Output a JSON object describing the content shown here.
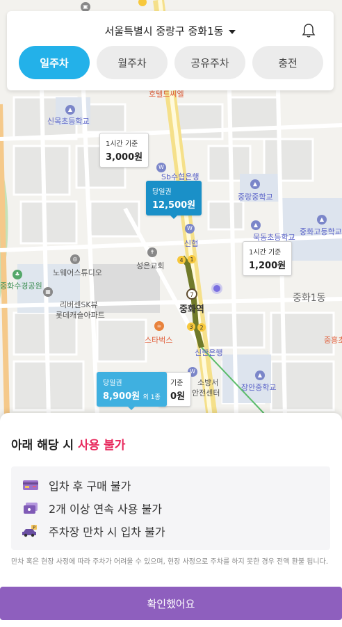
{
  "header": {
    "location": "서울특별시 중랑구 중화1동",
    "tabs": [
      {
        "label": "일주차",
        "active": true
      },
      {
        "label": "월주차",
        "active": false
      },
      {
        "label": "공유주차",
        "active": false
      },
      {
        "label": "충전",
        "active": false
      }
    ]
  },
  "map": {
    "pois": {
      "sinmok": "신목초등학교",
      "hotel": "호텔드씨엘",
      "sb": "Sb수협은행",
      "junglang_mid": "중랑중학교",
      "mukdong": "묵동초등학교",
      "junghwa_high": "중화고등학교",
      "norwest": "노웨어스튜디오",
      "seongeun": "성은교회",
      "sinhyup": "신협",
      "riversen": "리버센SK뷰",
      "rotte": "롯데캐슬아파트",
      "junghwa_station": "중화역",
      "junghwa1": "중화1동",
      "starbucks": "스타벅스",
      "shinhan": "신한은행",
      "fire": "소방서",
      "safety": "안전센터",
      "jangan": "장안중학교",
      "park": "중화수경공원",
      "junghwa_short": "중흥초",
      "gi": "기준",
      "won": "0원"
    },
    "tags": [
      {
        "line1": "1시간 기준",
        "line2": "3,000원",
        "style": "white"
      },
      {
        "line1": "당일권",
        "line2": "12,500원",
        "style": "blue"
      },
      {
        "line1": "1시간 기준",
        "line2": "1,200원",
        "style": "white"
      },
      {
        "line1": "당일권",
        "line2": "8,900원",
        "extra": "외 1종",
        "style": "lightblue"
      }
    ],
    "station_lines": [
      "4",
      "1",
      "7",
      "3",
      "2"
    ]
  },
  "sheet": {
    "title_prefix": "아래 해당 시 ",
    "title_highlight": "사용 불가",
    "restrictions": [
      {
        "icon": "credit-card-icon",
        "label": "입차 후 구매 불가"
      },
      {
        "icon": "tickets-icon",
        "label": "2개 이상 연속 사용 불가"
      },
      {
        "icon": "parking-car-icon",
        "label": "주차장 만차 시 입차 불가"
      }
    ],
    "notice": "만차 혹은 현장 사정에 따라 주차가 어려울 수 있으며, 현장 사정으로 주차를 하지 못한 경우 전액 환불 됩니다.",
    "confirm_label": "확인했어요"
  },
  "colors": {
    "tab_active": "#23b1e9",
    "highlight": "#e8285c",
    "confirm": "#8e5fbe",
    "tag_blue": "#1a90c8",
    "tag_lightblue": "#3fb0e0"
  }
}
